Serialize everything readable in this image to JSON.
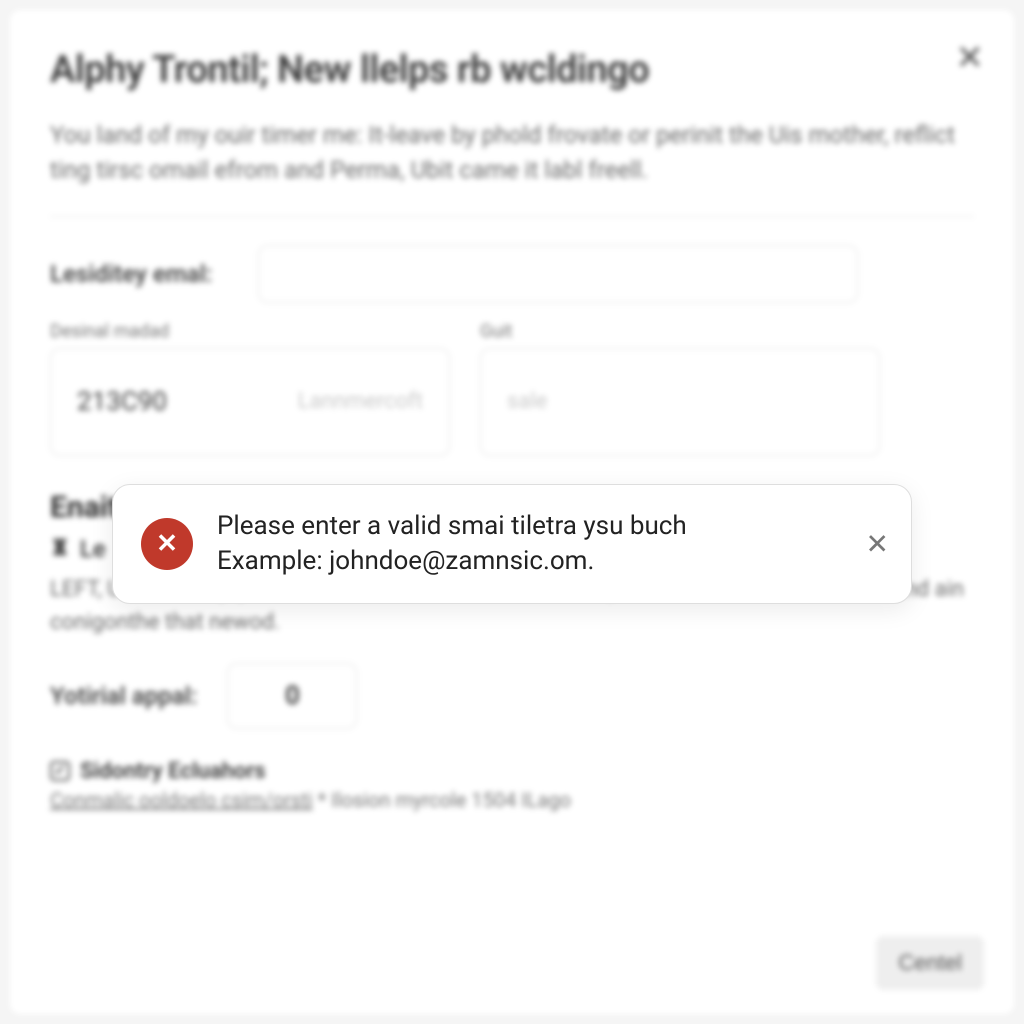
{
  "modal": {
    "title": "Alphy Trontil; New llelps rb wcldingo",
    "description": "You land of my ouir timer me: It-leave by phold frovate or perinit the Uis mother, reflict ting tirsc omail efrom and Perma, Ubit came it labl freell.",
    "close_icon_glyph": "✕",
    "email_field": {
      "label": "Lesiditey emal:",
      "placeholder": ""
    },
    "columns": {
      "left_header": "Desinal madad",
      "right_header": "Guit",
      "left_value": "213C90",
      "left_ghost": "Lannmercoft",
      "right_ghost": "sale"
    },
    "section_title": "Enait",
    "subrow": {
      "glyph": "♜",
      "text": "Le"
    },
    "paragraph": "LEFT, Uch suce injoy dessid this email address, melits be ponk drewr to chlinc Lovel Jound ain conigonthe that newod.",
    "appal": {
      "label": "Yotirial appal:",
      "value": "0"
    },
    "checkline": {
      "check_glyph": "✓",
      "text": "Sidontry Ecluahors"
    },
    "meta": {
      "link_text": "Conmalic ooldoelo csim/orsti",
      "rest": " * Ilosion myrcole 1504 ILago"
    },
    "footer": {
      "cancel_label": "Centel"
    }
  },
  "toast": {
    "error_icon_glyph": "✕",
    "line1": "Please enter a valid smai tiletra ysu buch",
    "line2": "Example: johndoe@zamnsic.om.",
    "dismiss_glyph": "✕"
  }
}
